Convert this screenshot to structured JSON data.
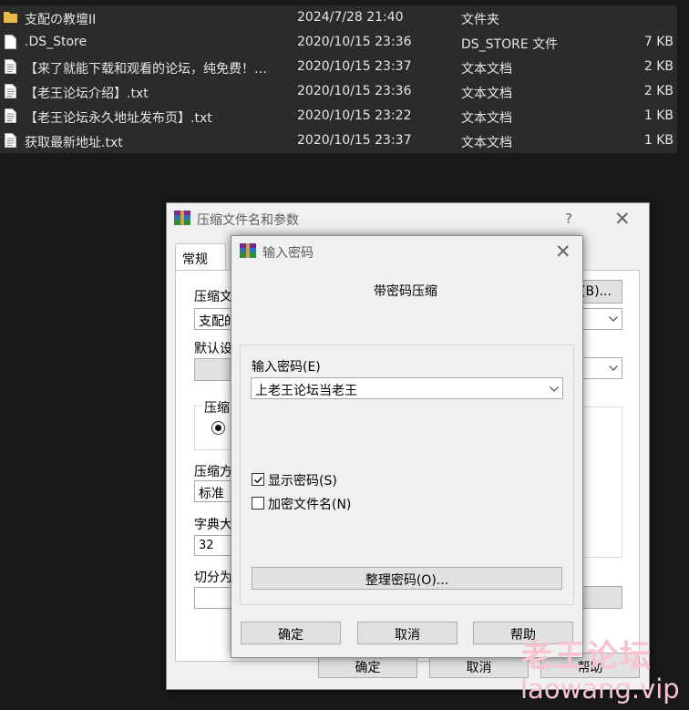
{
  "files": [
    {
      "icon": "folder-icon",
      "name": "支配の教壇II",
      "date": "2024/7/28 21:40",
      "type": "文件夹",
      "size": ""
    },
    {
      "icon": "file-icon",
      "name": ".DS_Store",
      "date": "2020/10/15 23:36",
      "type": "DS_STORE 文件",
      "size": "7 KB"
    },
    {
      "icon": "text-file-icon",
      "name": "【来了就能下载和观看的论坛，纯免费！…",
      "date": "2020/10/15 23:37",
      "type": "文本文档",
      "size": "2 KB"
    },
    {
      "icon": "text-file-icon",
      "name": "【老王论坛介绍】.txt",
      "date": "2020/10/15 23:36",
      "type": "文本文档",
      "size": "2 KB"
    },
    {
      "icon": "text-file-icon",
      "name": "【老王论坛永久地址发布页】.txt",
      "date": "2020/10/15 23:22",
      "type": "文本文档",
      "size": "1 KB"
    },
    {
      "icon": "text-file-icon",
      "name": "获取最新地址.txt",
      "date": "2020/10/15 23:37",
      "type": "文本文档",
      "size": "1 KB"
    }
  ],
  "archive_dialog": {
    "title": "压缩文件名和参数",
    "help": "?",
    "tab_general": "常规",
    "archive_name_label": "压缩文",
    "archive_name_value": "支配的",
    "browse_button": "(B)...",
    "default_label": "默认设",
    "format_label": "压缩",
    "method_label": "压缩方",
    "method_value": "标准",
    "dict_label": "字典大",
    "dict_value": "32",
    "split_label": "切分为",
    "paren_fragment": ")",
    "ok": "确定",
    "cancel": "取消",
    "help_button": "帮助"
  },
  "password_dialog": {
    "title": "输入密码",
    "heading": "带密码压缩",
    "enter_label": "输入密码(E)",
    "password_value": "上老王论坛当老王",
    "show_password_label": "显示密码(S)",
    "show_password_checked": true,
    "encrypt_names_label": "加密文件名(N)",
    "encrypt_names_checked": false,
    "organize_button": "整理密码(O)...",
    "ok": "确定",
    "cancel": "取消",
    "help_button": "帮助"
  },
  "watermark": {
    "title": "老王论坛",
    "url": "laowang.vip"
  },
  "colors": {
    "explorer_bg": "#2b2b2b",
    "desktop_bg": "#191919",
    "dialog_bg": "#f0f0f0",
    "folder_yellow": "#e8b84a",
    "watermark_pink": "#f7c3cf"
  }
}
